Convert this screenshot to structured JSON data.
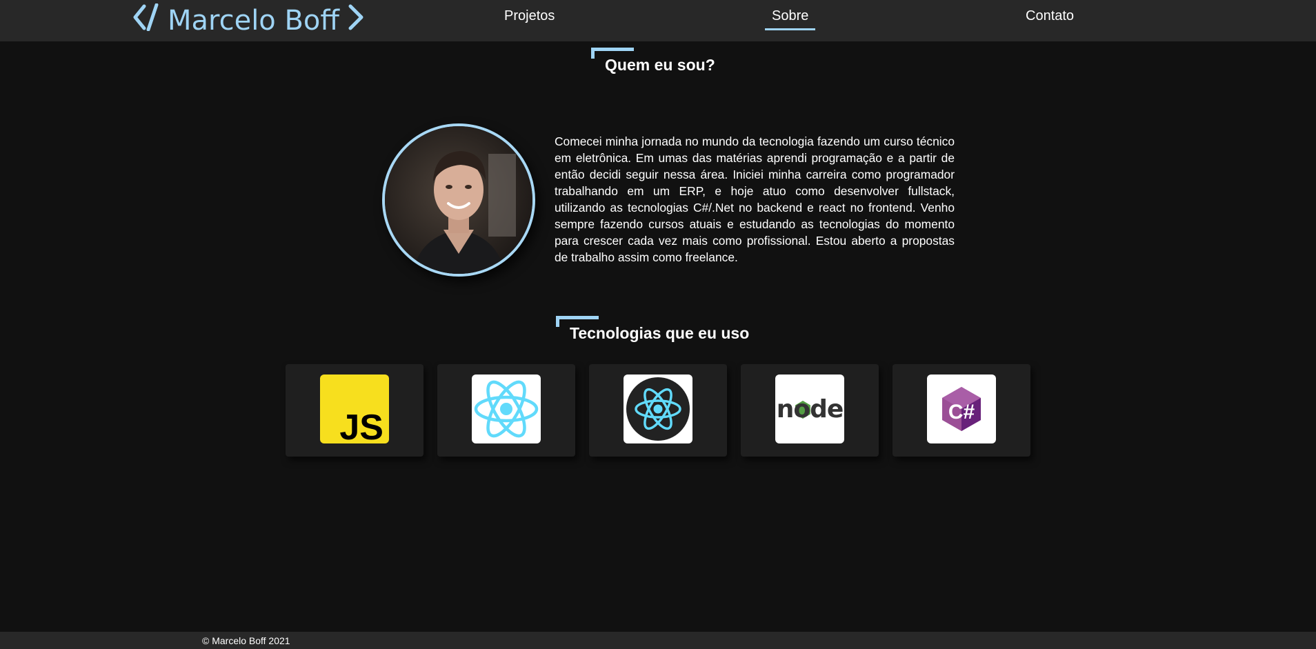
{
  "header": {
    "brand_name": "Marcelo Boff",
    "nav": [
      {
        "label": "Projetos"
      },
      {
        "label": "Sobre",
        "active": true
      },
      {
        "label": "Contato"
      }
    ]
  },
  "about": {
    "heading": "Quem eu sou?",
    "text": "Comecei minha jornada no mundo da tecnologia fazendo um curso técnico em eletrônica. Em umas das matérias aprendi programação e a partir de então decidi seguir nessa área. Iniciei minha carreira como programador trabalhando em um ERP, e hoje atuo como desenvolver fullstack, utilizando as tecnologias C#/.Net no backend e react no frontend. Venho sempre fazendo cursos atuais e estudando as tecnologias do momento para crescer cada vez mais como profissional. Estou aberto a propostas de trabalho assim como freelance."
  },
  "technologies": {
    "heading": "Tecnologias que eu uso",
    "items": [
      {
        "icon": "javascript-icon",
        "logo_text": "JS"
      },
      {
        "icon": "react-icon"
      },
      {
        "icon": "react-native-icon"
      },
      {
        "icon": "nodejs-icon",
        "logo_text": "node"
      },
      {
        "icon": "csharp-icon",
        "logo_text": "C#"
      }
    ]
  },
  "footer": {
    "copyright": "© Marcelo Boff 2021"
  },
  "colors": {
    "accent": "#9fd4f5",
    "background": "#111111",
    "header_background": "#282828",
    "card_background": "#1f1f1f",
    "javascript_yellow": "#f7df1e",
    "react_cyan": "#61dafb",
    "node_green": "#539e43",
    "csharp_purple": "#9b4f96"
  }
}
